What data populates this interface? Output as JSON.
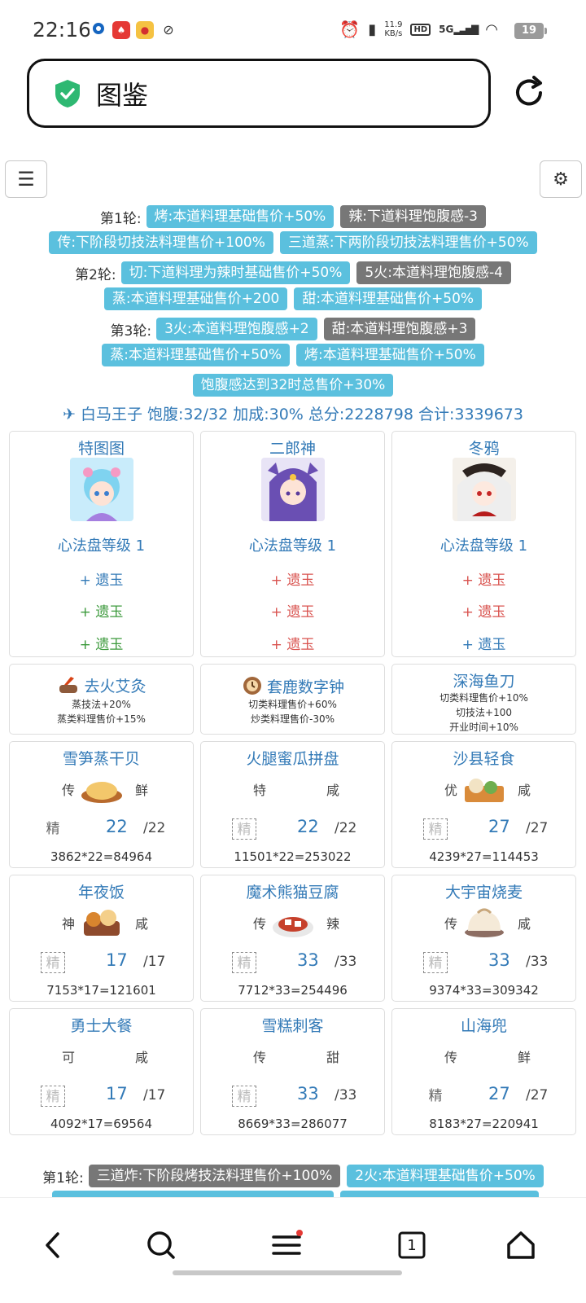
{
  "status_bar": {
    "time": "22:16",
    "net_speed_value": "11.9",
    "net_speed_unit": "KB/s",
    "hd": "HD",
    "signal": "5G",
    "battery": "19"
  },
  "address_bar": {
    "title": "图鉴"
  },
  "rules": {
    "r1_label": "第1轮:",
    "r1_tag1": "烤:本道料理基础售价+50%",
    "r1_tag2": "辣:下道料理饱腹感-3",
    "r1_tag3": "传:下阶段切技法料理售价+100%",
    "r1_tag4": "三道蒸:下两阶段切技法料理售价+50%",
    "r2_label": "第2轮:",
    "r2_tag1": "切:下道料理为辣时基础售价+50%",
    "r2_tag2": "5火:本道料理饱腹感-4",
    "r2_tag3": "蒸:本道料理基础售价+200",
    "r2_tag4": "甜:本道料理基础售价+50%",
    "r3_label": "第3轮:",
    "r3_tag1": "3火:本道料理饱腹感+2",
    "r3_tag2": "甜:本道料理饱腹感+3",
    "r3_tag3": "蒸:本道料理基础售价+50%",
    "r3_tag4": "烤:本道料理基础售价+50%",
    "final_tag": "饱腹感达到32时总售价+30%"
  },
  "summary": "白马王子 饱腹:32/32 加成:30% 总分:2228798 合计:3339673",
  "chefs": [
    {
      "name": "特图图",
      "level": "心法盘等级 1",
      "jade": [
        "+ 遗玉",
        "+ 遗玉",
        "+ 遗玉"
      ]
    },
    {
      "name": "二郎神",
      "level": "心法盘等级 1",
      "jade": [
        "+ 遗玉",
        "+ 遗玉",
        "+ 遗玉"
      ]
    },
    {
      "name": "冬鸦",
      "level": "心法盘等级 1",
      "jade": [
        "+ 遗玉",
        "+ 遗玉",
        "+ 遗玉"
      ]
    }
  ],
  "equips": [
    {
      "name": "去火艾灸",
      "lines": [
        "蒸技法+20%",
        "蒸类料理售价+15%"
      ]
    },
    {
      "name": "套鹿数字钟",
      "lines": [
        "切类料理售价+60%",
        "炒类料理售价-30%"
      ]
    },
    {
      "name": "深海鱼刀",
      "lines": [
        "切类料理售价+10%",
        "切技法+100",
        "开业时间+10%"
      ]
    }
  ],
  "dishes": [
    {
      "name": "雪笋蒸干贝",
      "rank": "传",
      "flavor": "鲜",
      "jing": "精",
      "qty": "22",
      "max": "/22",
      "formula": "3862*22=84964"
    },
    {
      "name": "火腿蜜瓜拼盘",
      "rank": "特",
      "flavor": "咸",
      "jing": "精",
      "qty": "22",
      "max": "/22",
      "formula": "11501*22=253022"
    },
    {
      "name": "沙县轻食",
      "rank": "优",
      "flavor": "咸",
      "jing": "精",
      "qty": "27",
      "max": "/27",
      "formula": "4239*27=114453"
    },
    {
      "name": "年夜饭",
      "rank": "神",
      "flavor": "咸",
      "jing": "精",
      "qty": "17",
      "max": "/17",
      "formula": "7153*17=121601"
    },
    {
      "name": "魔术熊猫豆腐",
      "rank": "传",
      "flavor": "辣",
      "jing": "精",
      "qty": "33",
      "max": "/33",
      "formula": "7712*33=254496"
    },
    {
      "name": "大宇宙烧麦",
      "rank": "传",
      "flavor": "咸",
      "jing": "精",
      "qty": "33",
      "max": "/33",
      "formula": "9374*33=309342"
    },
    {
      "name": "勇士大餐",
      "rank": "可",
      "flavor": "咸",
      "jing": "精",
      "qty": "17",
      "max": "/17",
      "formula": "4092*17=69564"
    },
    {
      "name": "雪糕刺客",
      "rank": "传",
      "flavor": "甜",
      "jing": "精",
      "qty": "33",
      "max": "/33",
      "formula": "8669*33=286077"
    },
    {
      "name": "山海兜",
      "rank": "传",
      "flavor": "鲜",
      "jing": "精",
      "qty": "27",
      "max": "/27",
      "formula": "8183*27=220941"
    }
  ],
  "next": {
    "label": "第1轮:",
    "tag1": "三道炸:下阶段烤技法料理售价+100%",
    "tag2": "2火:本道料理基础售价+50%"
  },
  "colors": {
    "accent": "#337ab7",
    "tag_blue": "#5bc0de",
    "tag_gray": "#777777",
    "jade_red": "#d9534f",
    "jade_green": "#3c9a3c"
  },
  "bottom_nav": {
    "tab_count": "1"
  }
}
